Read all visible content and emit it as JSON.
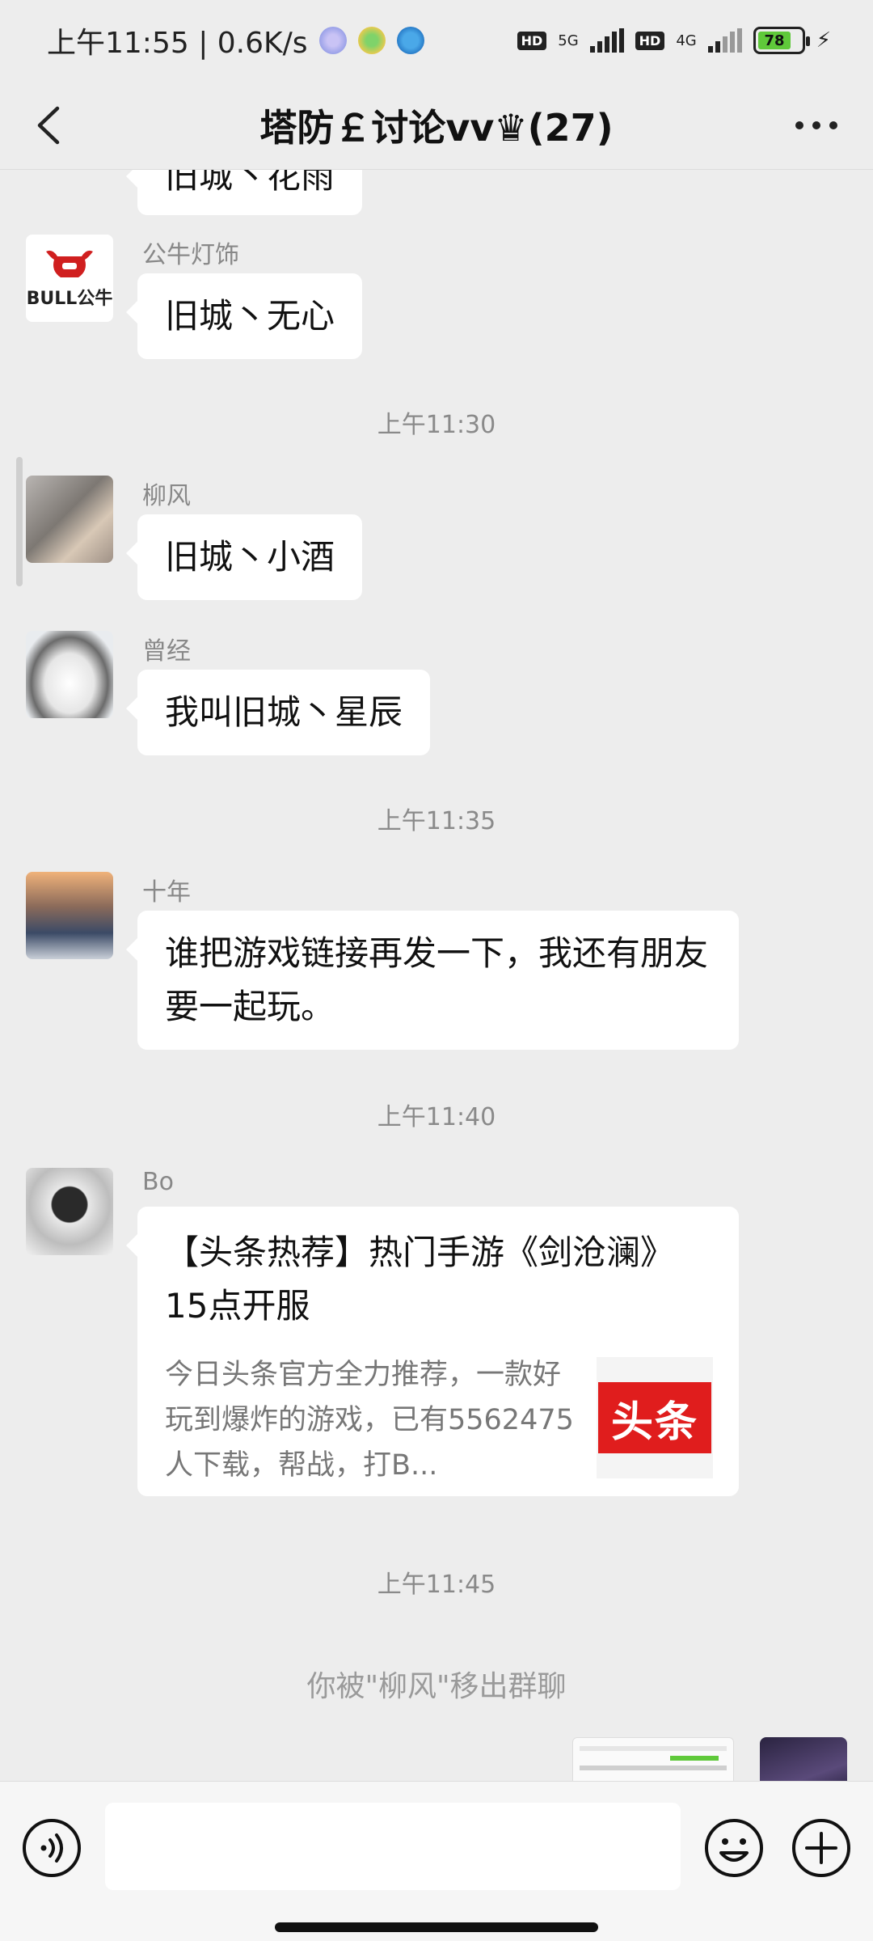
{
  "status_bar": {
    "time_speed": "上午11:55 | 0.6K/s",
    "net1": "5G",
    "net2": "4G",
    "hd": "HD",
    "battery": "78"
  },
  "header": {
    "title": "塔防￡讨论vv♛(27)"
  },
  "messages": {
    "partial_top": "旧城丶花雨",
    "m1": {
      "sender": "公牛灯饰",
      "avatar_text": "BULL公牛",
      "text": "旧城丶无心"
    },
    "t1": "上午11:30",
    "m2": {
      "sender": "柳风",
      "text": "旧城丶小酒"
    },
    "m3": {
      "sender": "曾经",
      "text": "我叫旧城丶星辰"
    },
    "t2": "上午11:35",
    "m4": {
      "sender": "十年",
      "text": "谁把游戏链接再发一下，我还有朋友要一起玩。"
    },
    "t3": "上午11:40",
    "m5": {
      "sender": "Bo",
      "card_title": "【头条热荐】热门手游《剑沧澜》15点开服",
      "card_desc": "今日头条官方全力推荐，一款好玩到爆炸的游戏，已有5562475人下载，帮战，打B...",
      "thumb_text": "头条"
    },
    "t4": "上午11:45",
    "system": "你被\"柳风\"移出群聊"
  },
  "input": {
    "placeholder": ""
  },
  "icons": {
    "back": "chevron-left-icon",
    "more": "more-dots-icon",
    "voice": "voice-icon",
    "emoji": "emoji-icon",
    "plus": "plus-icon"
  }
}
